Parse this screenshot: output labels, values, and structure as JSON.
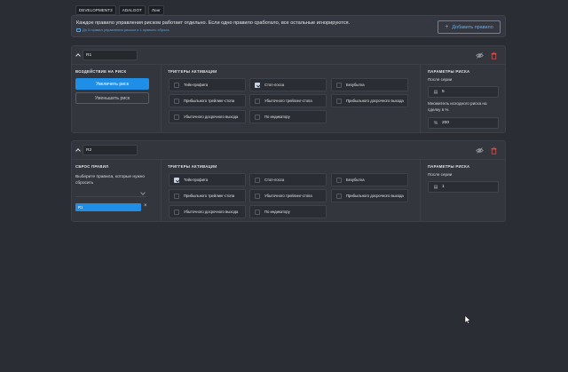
{
  "tabs": [
    "DEVELOPMENT3",
    "ADALGOT",
    "Лонг"
  ],
  "info": {
    "text": "Каждое правило управления риском работает отдельно. Если одно правило сработало, все остальные игнорируются.",
    "sub": "До 5 правил управления риском и 1 правило сброса",
    "add_button": "Добавить правило"
  },
  "rule1": {
    "name": "R1",
    "effect_title": "ВОЗДЕЙСТВИЕ НА РИСК",
    "increase": "Увеличить риск",
    "decrease": "Уменьшить риск",
    "triggers_title": "ТРИГГЕРЫ АКТИВАЦИИ",
    "triggers": [
      {
        "label": "Тейк-профита",
        "checked": false
      },
      {
        "label": "Стоп-лосса",
        "checked": true
      },
      {
        "label": "Безубытка",
        "checked": false
      },
      {
        "label": "Прибыльного трейлинг-стопа",
        "checked": false
      },
      {
        "label": "Убыточного трейлинг-стопа",
        "checked": false
      },
      {
        "label": "Прибыльного досрочного выхода",
        "checked": false
      },
      {
        "label": "Убыточного досрочного выхода",
        "checked": false
      },
      {
        "label": "По индикатору",
        "checked": false
      }
    ],
    "params_title": "ПАРАМЕТРЫ РИСКА",
    "after_series_label": "После серии",
    "after_series_value": "5",
    "multiplier_label": "Множитель исходного риска на сделку в %",
    "multiplier_value": "200"
  },
  "rule2": {
    "name": "R2",
    "reset_title": "СБРОС ПРАВИЛ",
    "select_hint": "Выберите правила, которые нужно сбросить",
    "chip": "R1",
    "triggers_title": "ТРИГГЕРЫ АКТИВАЦИИ",
    "triggers": [
      {
        "label": "Тейк-профита",
        "checked": true
      },
      {
        "label": "Стоп-лосса",
        "checked": false
      },
      {
        "label": "Безубытка",
        "checked": false
      },
      {
        "label": "Прибыльного трейлинг-стопа",
        "checked": false
      },
      {
        "label": "Убыточного трейлинг-стопа",
        "checked": false
      },
      {
        "label": "Прибыльного досрочного выхода",
        "checked": false
      },
      {
        "label": "Убыточного досрочного выхода",
        "checked": false
      },
      {
        "label": "По индикатору",
        "checked": false
      }
    ],
    "params_title": "ПАРАМЕТРЫ РИСКА",
    "after_series_label": "После серии",
    "after_series_value": "1"
  }
}
